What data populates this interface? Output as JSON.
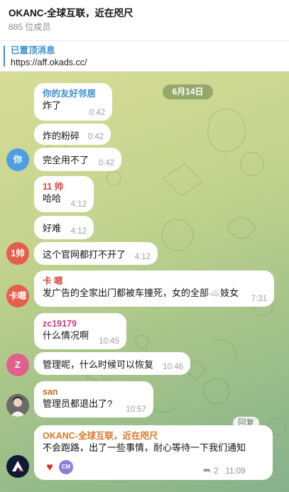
{
  "header": {
    "title": "OKANC-全球互联，近在咫尺",
    "subtitle": "885 位成员"
  },
  "pinned": {
    "label": "已置顶消息",
    "text": "https://aff.okads.cc/"
  },
  "date_pill": "6月14日",
  "groups": [
    {
      "sender": "你的友好邻居",
      "sender_color": "#3a8fd0",
      "avatar_text": "你",
      "avatar_color": "#4e9ee3",
      "messages": [
        {
          "text": "炸了",
          "time": "0:42"
        },
        {
          "text": "炸的粉碎",
          "time": "0:42"
        },
        {
          "text": "完全用不了",
          "time": "0:42"
        }
      ]
    },
    {
      "sender": "11 帅",
      "sender_color": "#d9423f",
      "avatar_text": "1帅",
      "avatar_color": "#e45f4b",
      "messages": [
        {
          "text": "哈哈",
          "time": "4:12"
        },
        {
          "text": "好难",
          "time": "4:12"
        },
        {
          "text": "这个官网都打不开了",
          "time": "4:12"
        }
      ]
    },
    {
      "sender": "卡 嗯",
      "sender_color": "#d9423f",
      "avatar_text": "卡嗯",
      "avatar_color": "#e45f4b",
      "messages": [
        {
          "text": "发广告的全家出门都被车撞死，女的全部☁️妓女",
          "time": "7:31"
        }
      ]
    },
    {
      "sender": "zc19179",
      "sender_color": "#c7417b",
      "avatar_text": "Z",
      "avatar_color": "#e0618f",
      "messages": [
        {
          "text": "什么情况啊",
          "time": "10:45"
        },
        {
          "text": "管理呢，什么时候可以恢复",
          "time": "10:46"
        }
      ]
    },
    {
      "sender": "san",
      "sender_color": "#c26d1d",
      "avatar_text": "",
      "avatar_color": "#5a5a5a",
      "messages": [
        {
          "text": "管理员都退出了?",
          "time": "10:57"
        }
      ]
    },
    {
      "sender": "OKANC-全球互联，近在咫尺",
      "sender_color": "#d7782a",
      "avatar_text": "",
      "avatar_color": "#101a35",
      "messages": [
        {
          "text": "不会跑路，出了一些事情，耐心等待一下我们通知",
          "time": "11:09"
        }
      ],
      "reply_label": "回复",
      "reactions": [
        {
          "icon": "heart-icon",
          "glyph": "♥"
        },
        {
          "label": "CM"
        }
      ],
      "reply_count": "2"
    }
  ]
}
